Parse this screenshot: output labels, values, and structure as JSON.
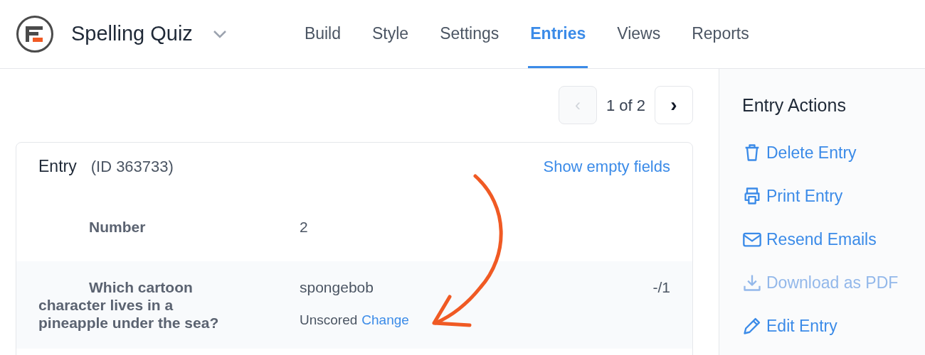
{
  "header": {
    "form_title": "Spelling Quiz",
    "tabs": [
      {
        "label": "Build",
        "selected": false
      },
      {
        "label": "Style",
        "selected": false
      },
      {
        "label": "Settings",
        "selected": false
      },
      {
        "label": "Entries",
        "selected": true
      },
      {
        "label": "Views",
        "selected": false
      },
      {
        "label": "Reports",
        "selected": false
      }
    ]
  },
  "pagination": {
    "prev": "‹",
    "reading": "1 of 2",
    "next": "›",
    "prev_disabled": true
  },
  "entry": {
    "title": "Entry",
    "id": "(ID 363733)",
    "show_empty": "Show empty fields",
    "rows": [
      {
        "label": "Number",
        "value": "2",
        "shaded": false
      },
      {
        "label": "Which cartoon character lives in a pineapple under the sea?",
        "value": "spongebob",
        "score": "-/1",
        "status": "Unscored",
        "action": "Change",
        "shaded": true
      }
    ]
  },
  "sidebar": {
    "title": "Entry Actions",
    "actions": [
      {
        "kind": "delete",
        "label": "Delete Entry",
        "disabled": false
      },
      {
        "kind": "print",
        "label": "Print Entry",
        "disabled": false
      },
      {
        "kind": "email",
        "label": "Resend Emails",
        "disabled": false
      },
      {
        "kind": "download",
        "label": "Download as PDF",
        "disabled": true
      },
      {
        "kind": "edit",
        "label": "Edit Entry",
        "disabled": false
      }
    ]
  }
}
